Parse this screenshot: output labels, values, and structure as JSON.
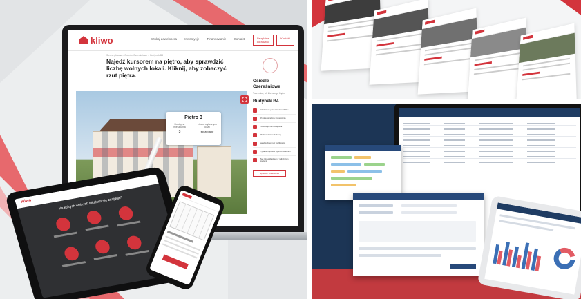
{
  "collage": {
    "panels": [
      "kliwo-responsive-mockup",
      "website-pages-mockup",
      "dashboard-app-mockup"
    ]
  },
  "brand": {
    "name": "kliwo",
    "accent": "#d3343c",
    "dark_navy": "#1c3555"
  },
  "website": {
    "nav_items": [
      "Szukaj dewelopera",
      "Inwestycje",
      "Finansowanie",
      "Kontakt"
    ],
    "nav_cta": [
      "Bezpłatne doradztwo",
      "Kontakt"
    ],
    "breadcrumb": "Strona główna » Osiedle Czereśniowe » Budynek B4",
    "headline": "Najedź kursorem na piętro, aby sprawdzić liczbę wolnych lokali. Kliknij, aby zobaczyć rzut piętra.",
    "floor_card": {
      "title": "Piętro 3",
      "available_label": "Dostępne mieszkania",
      "available_value": "3",
      "sold_label": "Liczba wybranych lokali",
      "sold_value": "sprzedane"
    },
    "estate_name": "Osiedle Czereśniowe",
    "estate_address": "Trzebnica, ul. Zielonego Dębu",
    "building": "Budynek B4",
    "features": [
      "Zakończenie prac w czerwcu 2020 r.",
      "Wysokie standardy wykończenia",
      "Proekologiczne rozwiązania",
      "Winda w klatce schodowej",
      "Garaż podziemny z możliwością",
      "Prywatne ogródki o wysokich walorach",
      "Plac zabaw dla dzieci w najbliższym otoczeniu"
    ],
    "side_button": "Sprawdź mieszkania"
  },
  "tablet": {
    "logo": "kliwo",
    "title": "Na których wolnych lokalach się znajduje?"
  }
}
